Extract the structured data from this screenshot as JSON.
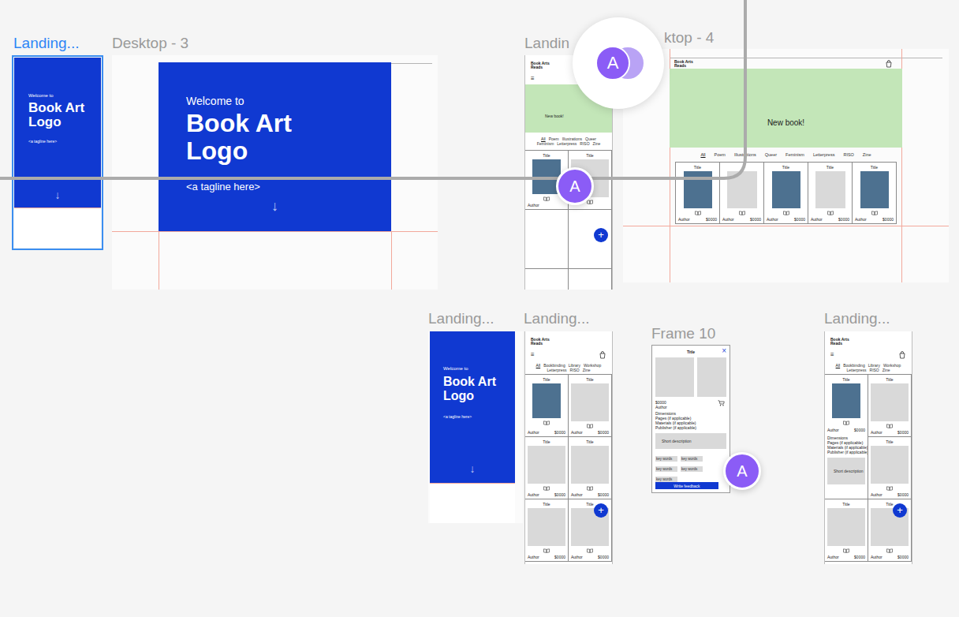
{
  "canvas": {
    "labels": [
      {
        "text": "Landing...",
        "selected": true
      },
      {
        "text": "Desktop - 3",
        "selected": false
      },
      {
        "text": "Landin",
        "selected": false
      },
      {
        "text": "ktop - 4",
        "selected": false
      },
      {
        "text": "Landing...",
        "selected": false
      },
      {
        "text": "Landing...",
        "selected": false
      },
      {
        "text": "Frame 10",
        "selected": false
      },
      {
        "text": "Landing...",
        "selected": false
      }
    ]
  },
  "hero_mobile": {
    "welcome": "Welcome to",
    "logo": "Book Art Logo",
    "tagline": "<a tagline here>",
    "arrow": "↓"
  },
  "hero_desktop": {
    "welcome": "Welcome to",
    "logo": "Book Art Logo",
    "tagline": "<a tagline here>",
    "arrow": "↓"
  },
  "hero_mobile_2": {
    "welcome": "Welcome to",
    "logo": "Book Art Logo",
    "tagline": "<a tagline here>",
    "arrow": "↓"
  },
  "store_mobile": {
    "brand": "Book Arts Reads",
    "menu": "≡",
    "banner": "New book!",
    "categories": [
      {
        "label": "All",
        "selected": true
      },
      {
        "label": "Poem",
        "selected": false
      },
      {
        "label": "Illustrations",
        "selected": false
      },
      {
        "label": "Queer",
        "selected": false
      },
      {
        "label": "Feminism",
        "selected": false
      },
      {
        "label": "Letterpress",
        "selected": false
      },
      {
        "label": "RISO",
        "selected": false
      },
      {
        "label": "Zine",
        "selected": false
      }
    ],
    "cards": [
      {
        "title": "Title",
        "kind": "cover",
        "author": "Author"
      },
      {
        "title": "Title",
        "kind": "blank"
      },
      {
        "kind": "empty"
      },
      {
        "kind": "empty"
      },
      {
        "kind": "empty"
      },
      {
        "kind": "empty"
      }
    ],
    "fab": "+"
  },
  "store_desktop": {
    "brand": "Book Arts Reads",
    "banner": "New book!",
    "categories": [
      {
        "label": "All",
        "selected": true
      },
      {
        "label": "Poem",
        "selected": false
      },
      {
        "label": "Illustrations",
        "selected": false
      },
      {
        "label": "Queer",
        "selected": false
      },
      {
        "label": "Feminism",
        "selected": false
      },
      {
        "label": "Letterpress",
        "selected": false
      },
      {
        "label": "RISO",
        "selected": false
      },
      {
        "label": "Zine",
        "selected": false
      }
    ],
    "cards": [
      {
        "title": "Title",
        "kind": "cover",
        "author": "Author",
        "price": "$0000"
      },
      {
        "kind": "blank",
        "author": "Author",
        "price": "$0000"
      },
      {
        "title": "Title",
        "kind": "cover",
        "author": "Author",
        "price": "$0000"
      },
      {
        "title": "Title",
        "kind": "blank",
        "author": "Author",
        "price": "$0000"
      },
      {
        "title": "Title",
        "kind": "cover",
        "author": "Author",
        "price": "$0000"
      }
    ]
  },
  "store_mobile_2": {
    "brand": "Book Arts Reads",
    "menu": "≡",
    "categories": [
      {
        "label": "All",
        "selected": true
      },
      {
        "label": "Bookbinding",
        "selected": false
      },
      {
        "label": "Library",
        "selected": false
      },
      {
        "label": "Workshop",
        "selected": false
      },
      {
        "label": "Letterpress",
        "selected": false
      },
      {
        "label": "RISO",
        "selected": false
      },
      {
        "label": "Zine",
        "selected": false
      }
    ],
    "cards": [
      {
        "title": "Title",
        "kind": "cover",
        "author": "Author",
        "price": "$0000"
      },
      {
        "title": "Title",
        "kind": "blank",
        "author": "Author",
        "price": "$0000"
      },
      {
        "title": "Title",
        "kind": "blank",
        "author": "Author",
        "price": "$0000"
      },
      {
        "title": "Title",
        "kind": "blank",
        "author": "Author",
        "price": "$0000"
      },
      {
        "title": "Title",
        "kind": "blank",
        "author": "Author",
        "price": "$0000"
      },
      {
        "title": "Title",
        "kind": "blank",
        "author": "Author",
        "price": "$0000"
      }
    ],
    "fab": "+"
  },
  "product_detail": {
    "title": "Title",
    "close": "×",
    "price": "$0000",
    "author": "Author",
    "specs": [
      "Dimensions",
      "Pages (if applicable)",
      "Materials (if applicable)",
      "Publisher (if applicable)"
    ],
    "description": "Short description",
    "keywords": [
      "key words",
      "key words",
      "key words",
      "key words",
      "key words"
    ],
    "button": "Write feedback"
  },
  "store_mobile_3": {
    "brand": "Book Arts Reads",
    "menu": "≡",
    "categories": [
      {
        "label": "All",
        "selected": true
      },
      {
        "label": "Bookbinding",
        "selected": false
      },
      {
        "label": "Library",
        "selected": false
      },
      {
        "label": "Workshop",
        "selected": false
      },
      {
        "label": "Letterpress",
        "selected": false
      },
      {
        "label": "RISO",
        "selected": false
      },
      {
        "label": "Zine",
        "selected": false
      }
    ],
    "cards": [
      {
        "title": "Title",
        "kind": "cover",
        "author": "Author",
        "price": "$0000",
        "expanded": true,
        "specs": [
          "Dimensions",
          "Pages (if applicable)",
          "Materials (if applicable)",
          "Publisher (if applicable)"
        ],
        "description": "Short description"
      },
      {
        "title": "Title",
        "kind": "blank",
        "author": "Author",
        "price": "$0000",
        "expanded": false
      },
      {
        "title": "Title",
        "kind": "blank",
        "author": "Author",
        "price": "$0000",
        "expanded": false
      },
      {
        "title": "Title",
        "kind": "blank",
        "author": "Author",
        "price": "$0000",
        "expanded": false
      },
      {
        "title": "Title",
        "kind": "blank",
        "author": "Author",
        "price": "$0000",
        "expanded": false
      }
    ],
    "fab": "+"
  },
  "avatars": [
    {
      "letter": "A"
    },
    {
      "letter": "A"
    },
    {
      "letter": "A"
    }
  ]
}
